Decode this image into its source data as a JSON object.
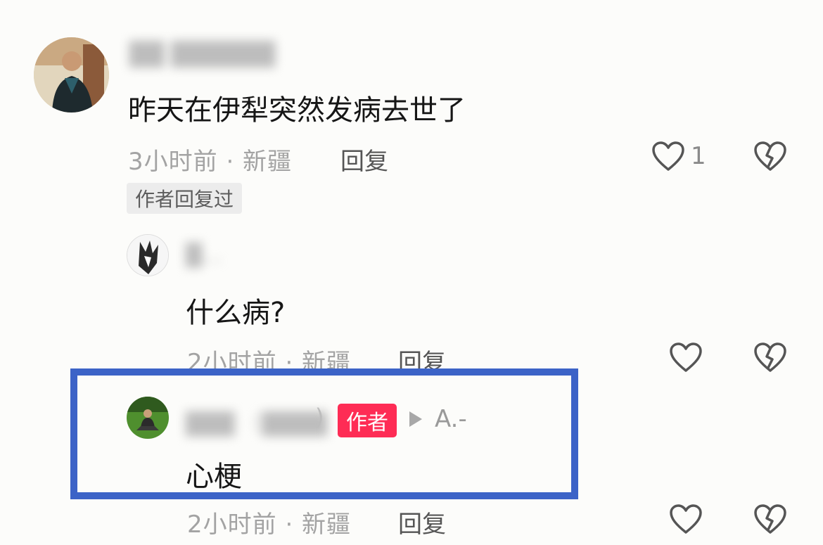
{
  "comment_main": {
    "username": "██ ██████",
    "text": "昨天在伊犁突然发病去世了",
    "meta": "3小时前 · 新疆",
    "reply_label": "回复",
    "like_count": "1",
    "author_replied_tag": "作者回复过"
  },
  "reply_1": {
    "username": "█...",
    "text": "什么病?",
    "meta": "2小时前 · 新疆",
    "reply_label": "回复"
  },
  "reply_2": {
    "username": "███ （████",
    "username_tail": ")",
    "author_badge": "作者",
    "reply_to": "A.-",
    "text": "心梗",
    "meta": "2小时前 · 新疆",
    "reply_label": "回复"
  },
  "colors": {
    "highlight_border": "#3c63c7",
    "author_badge_bg": "#fe2c55",
    "background": "#fcfcfa"
  },
  "icons": {
    "like": "heart-outline-icon",
    "dislike": "broken-heart-icon",
    "reply_arrow": "play-triangle-icon"
  }
}
